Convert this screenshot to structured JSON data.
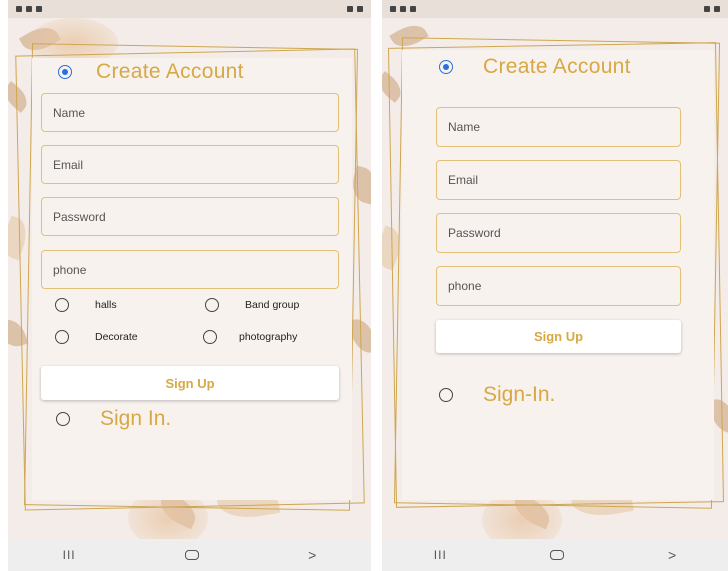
{
  "left": {
    "title": "Create Account",
    "fields": {
      "name": "Name",
      "email": "Email",
      "password": "Password",
      "phone": "phone"
    },
    "options": {
      "halls": "halls",
      "band_group": "Band group",
      "decorate": "Decorate",
      "photography": "photography"
    },
    "signup_label": "Sign Up",
    "signin_label": "Sign In."
  },
  "right": {
    "title": "Create Account",
    "fields": {
      "name": "Name",
      "email": "Email",
      "password": "Password",
      "phone": "phone"
    },
    "signup_label": "Sign Up",
    "signin_label": "Sign-In."
  },
  "navbar": {
    "recent_glyph": "III",
    "back_glyph": ">"
  },
  "colors": {
    "accent_gold": "#d7a844",
    "radio_selected": "#2a6fdb",
    "field_border": "#e2c078"
  }
}
